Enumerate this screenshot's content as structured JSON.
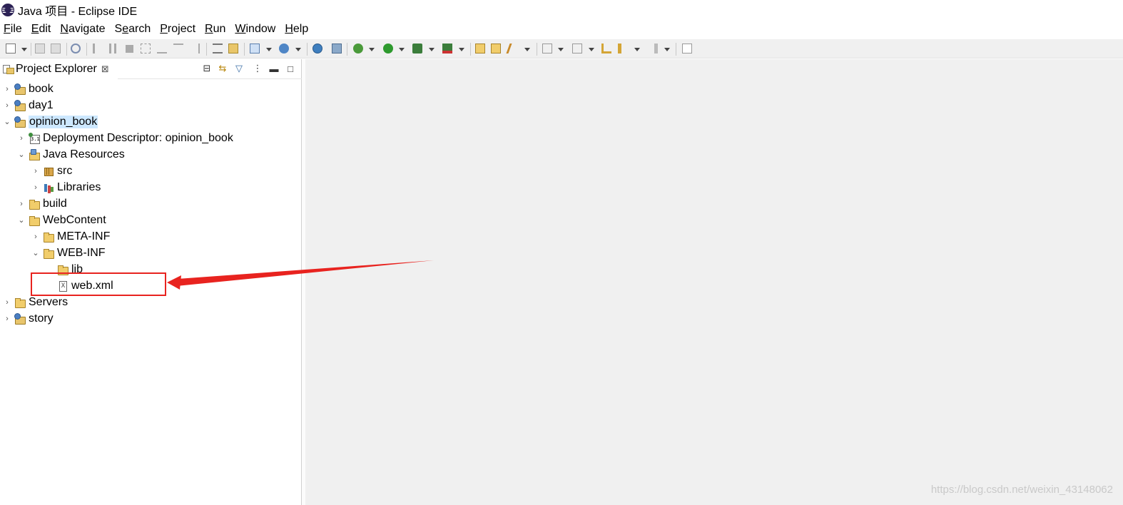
{
  "window": {
    "title": "Java 项目 - Eclipse IDE"
  },
  "menu": [
    {
      "mnemonic": "F",
      "rest": "ile"
    },
    {
      "mnemonic": "E",
      "rest": "dit"
    },
    {
      "mnemonic": "N",
      "rest": "avigate"
    },
    {
      "mnemonic": "S",
      "rest": "e",
      "suffix": "arch"
    },
    {
      "mnemonic": "P",
      "rest": "roject"
    },
    {
      "mnemonic": "R",
      "rest": "un"
    },
    {
      "mnemonic": "W",
      "rest": "indow"
    },
    {
      "mnemonic": "H",
      "rest": "elp"
    }
  ],
  "explorer": {
    "tab_label": "Project Explorer",
    "close_glyph": "⊠",
    "tree": [
      {
        "label": "book",
        "icon": "project-icon",
        "expanded": false
      },
      {
        "label": "day1",
        "icon": "project-icon",
        "expanded": false
      },
      {
        "label": "opinion_book",
        "icon": "project-icon",
        "expanded": true,
        "selected": true
      },
      {
        "label": "Deployment Descriptor: opinion_book",
        "icon": "deployment-descriptor-icon",
        "expanded": false
      },
      {
        "label": "Java Resources",
        "icon": "java-resources-icon",
        "expanded": true
      },
      {
        "label": "src",
        "icon": "package-folder-icon",
        "expanded": false
      },
      {
        "label": "Libraries",
        "icon": "libraries-icon",
        "expanded": false
      },
      {
        "label": "build",
        "icon": "folder-icon",
        "expanded": false
      },
      {
        "label": "WebContent",
        "icon": "folder-icon",
        "expanded": true
      },
      {
        "label": "META-INF",
        "icon": "folder-icon",
        "expanded": false
      },
      {
        "label": "WEB-INF",
        "icon": "folder-icon",
        "expanded": true
      },
      {
        "label": "lib",
        "icon": "folder-icon"
      },
      {
        "label": "web.xml",
        "icon": "xml-file-icon",
        "highlighted": true
      },
      {
        "label": "Servers",
        "icon": "folder-icon",
        "expanded": false
      },
      {
        "label": "story",
        "icon": "project-icon",
        "expanded": false
      }
    ]
  },
  "annotation": {
    "color": "#e8231f"
  },
  "watermark": "https://blog.csdn.net/weixin_43148062"
}
